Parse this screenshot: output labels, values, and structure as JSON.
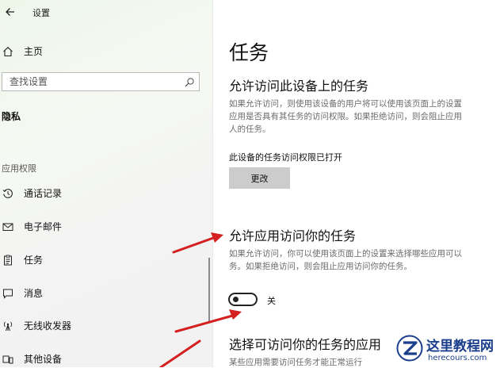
{
  "window": {
    "title": "设置"
  },
  "sidebar": {
    "home_label": "主页",
    "search_placeholder": "查找设置",
    "section_title": "隐私",
    "group_label": "应用权限",
    "items": [
      {
        "label": "通话记录",
        "icon": "history-icon"
      },
      {
        "label": "电子邮件",
        "icon": "mail-icon"
      },
      {
        "label": "任务",
        "icon": "tasks-icon"
      },
      {
        "label": "消息",
        "icon": "message-icon"
      },
      {
        "label": "无线收发器",
        "icon": "radio-icon"
      },
      {
        "label": "其他设备",
        "icon": "devices-icon"
      }
    ]
  },
  "main": {
    "page_title": "任务",
    "section1": {
      "heading": "允许访问此设备上的任务",
      "desc_lines": [
        "如果允许访问，则使用该设备的用户将可以使用该页面上的设置",
        "应用是否具有其任务的访问权限。如果拒绝访问，则会阻止应用",
        "人的任务。"
      ],
      "status": "此设备的任务访问权限已打开",
      "button": "更改"
    },
    "section2": {
      "heading": "允许应用访问你的任务",
      "desc_lines": [
        "如果允许访问，你可以使用该页面上的设置来选择哪些应用可以",
        "务。如果拒绝访问，则会阻止应用访问你的任务。"
      ],
      "toggle_state": "off",
      "toggle_label": "关"
    },
    "section3": {
      "heading": "选择可访问你的任务的应用",
      "desc": "某些应用需要访问任务才能正常运行"
    }
  },
  "watermark": {
    "title": "这里教程网",
    "url": "herecours.com"
  },
  "colors": {
    "accent": "#222222",
    "annotation": "#d42020",
    "watermark": "#1b3f8c"
  }
}
